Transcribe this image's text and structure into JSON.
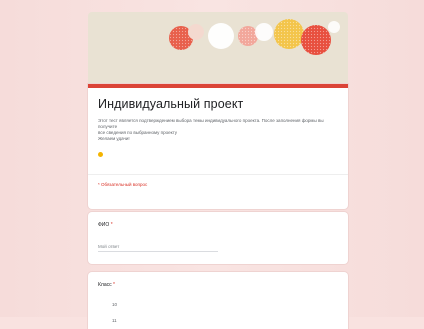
{
  "form": {
    "title": "Индивидуальный проект",
    "description_line1": "Этот тест является подтверждением выбора темы индивидуального проекта. После заполнения формы вы получите",
    "description_line2": "все сведения по выбранному проекту",
    "description_line3": "Желаем удачи!",
    "required_note": "* Обязательный вопрос",
    "accent_color": "#db4437",
    "banner_color": "#e9e2d3"
  },
  "questions": [
    {
      "label": "ФИО",
      "required": "*",
      "placeholder": "Мой ответ"
    },
    {
      "label": "Класс",
      "required": "*",
      "options": [
        "10",
        "11"
      ]
    }
  ]
}
